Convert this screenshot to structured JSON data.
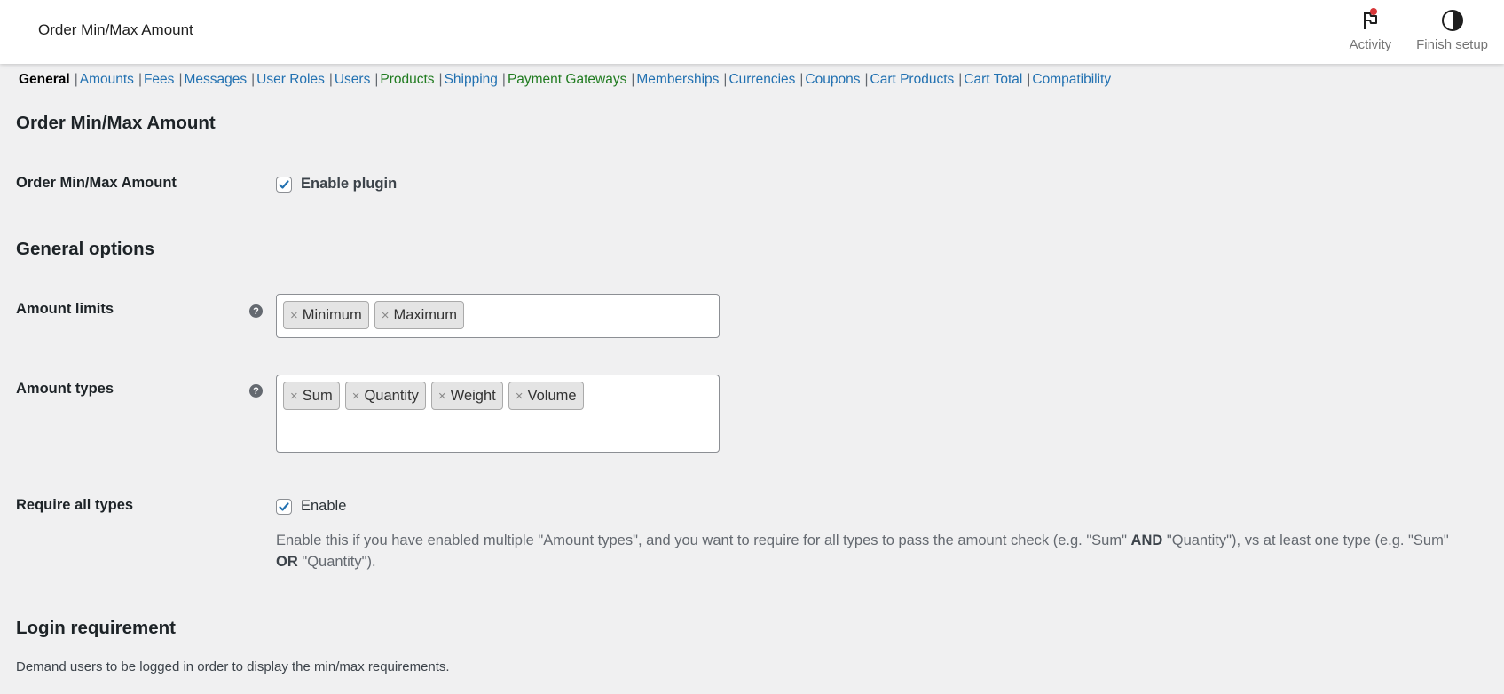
{
  "header": {
    "title": "Order Min/Max Amount",
    "actions": [
      {
        "label": "Activity",
        "icon": "flag-icon"
      },
      {
        "label": "Finish setup",
        "icon": "half-circle-icon"
      }
    ]
  },
  "subnav": {
    "items": [
      {
        "label": "General",
        "current": true
      },
      {
        "label": "Amounts"
      },
      {
        "label": "Fees"
      },
      {
        "label": "Messages"
      },
      {
        "label": "User Roles"
      },
      {
        "label": "Users"
      },
      {
        "label": "Products"
      },
      {
        "label": "Shipping"
      },
      {
        "label": "Payment Gateways"
      },
      {
        "label": "Memberships"
      },
      {
        "label": "Currencies"
      },
      {
        "label": "Coupons"
      },
      {
        "label": "Cart Products"
      },
      {
        "label": "Cart Total"
      },
      {
        "label": "Compatibility"
      }
    ]
  },
  "sections": {
    "main_title": "Order Min/Max Amount",
    "enable_label": "Order Min/Max Amount",
    "enable_plugin": {
      "label": "Enable plugin",
      "checked": true
    },
    "general_title": "General options",
    "amount_limits": {
      "label": "Amount limits",
      "chips": [
        "Minimum",
        "Maximum"
      ]
    },
    "amount_types": {
      "label": "Amount types",
      "chips": [
        "Sum",
        "Quantity",
        "Weight",
        "Volume"
      ]
    },
    "require_all": {
      "label": "Require all types",
      "checkbox_label": "Enable",
      "checked": true,
      "desc_part1": "Enable this if you have enabled multiple \"Amount types\", and you want to require for all types to pass the amount check (e.g. \"Sum\" ",
      "desc_and": "AND",
      "desc_part2": " \"Quantity\"), vs at least one type (e.g. \"Sum\" ",
      "desc_or": "OR",
      "desc_part3": " \"Quantity\")."
    },
    "login_title": "Login requirement",
    "login_desc": "Demand users to be logged in order to display the min/max requirements."
  },
  "colors": {
    "accent": "#2271b1",
    "green_link": "#207b20",
    "background": "#f0f0f1",
    "notification_dot": "#d63638"
  }
}
